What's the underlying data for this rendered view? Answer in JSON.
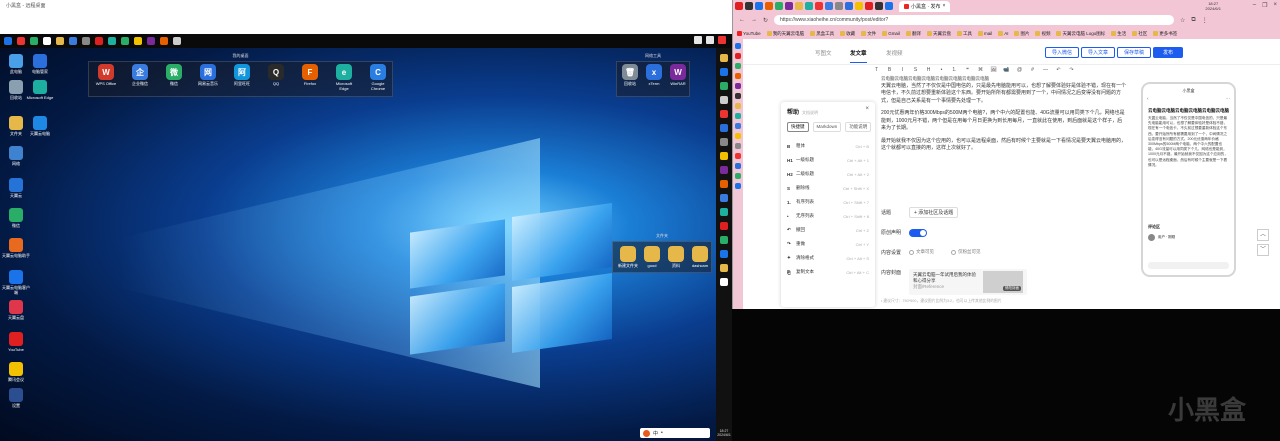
{
  "remote_window": {
    "title": "小黑盒 - 远程桌面",
    "taskbar_clock": {
      "time": "18:27",
      "date": "2024/6/1"
    }
  },
  "desktop_icons": [
    {
      "label": "此电脑",
      "color": "#4aa0e8"
    },
    {
      "label": "电脑管家",
      "color": "#2a6fdb"
    },
    {
      "label": "回收站",
      "color": "#8aa0b0"
    },
    {
      "label": "Microsoft Edge",
      "color": "#1db0a0"
    },
    {
      "label": "文件夹",
      "color": "#e6b84a"
    },
    {
      "label": "天翼云电脑",
      "color": "#1e88e5"
    },
    {
      "label": "网络",
      "color": "#3f82d0"
    },
    {
      "label": "天翼云",
      "color": "#2573d6"
    },
    {
      "label": "微信",
      "color": "#2aae67"
    },
    {
      "label": "天翼云电脑助手",
      "color": "#e86a1e"
    },
    {
      "label": "天翼云电脑客户端",
      "color": "#1a73e8"
    },
    {
      "label": "天翼云盘",
      "color": "#e0364b"
    },
    {
      "label": "YouTube",
      "color": "#e02020"
    },
    {
      "label": "腾讯会议",
      "color": "#f2c200"
    },
    {
      "label": "设置",
      "color": "#2a4e8f"
    }
  ],
  "app_group": {
    "title": "我的桌面",
    "items": [
      {
        "label": "WPS Office",
        "color": "#d23b2c",
        "glyph": "W"
      },
      {
        "label": "企业微信",
        "color": "#3a7be0",
        "glyph": "企"
      },
      {
        "label": "微信",
        "color": "#2aae67",
        "glyph": "微"
      },
      {
        "label": "网易云音乐",
        "color": "#2a6fdb",
        "glyph": "网"
      },
      {
        "label": "阿里旺旺",
        "color": "#1296db",
        "glyph": "阿"
      },
      {
        "label": "QQ",
        "color": "#2a2a2a",
        "glyph": "Q"
      },
      {
        "label": "Firefox",
        "color": "#e66000",
        "glyph": "F"
      },
      {
        "label": "Microsoft Edge",
        "color": "#1db0a0",
        "glyph": "e"
      },
      {
        "label": "Google Chrome",
        "color": "#2a7de1",
        "glyph": "C"
      }
    ]
  },
  "tools_group": {
    "title": "网络工具",
    "items": [
      {
        "label": "回收站",
        "color": "#7f8c97",
        "glyph": "🗑"
      },
      {
        "label": "xTerm",
        "color": "#2a6fdb",
        "glyph": "x"
      },
      {
        "label": "WinRAR",
        "color": "#7a2a9a",
        "glyph": "W"
      }
    ]
  },
  "files_group": {
    "title": "文件夹",
    "items": [
      {
        "label": "新建文件夹",
        "color": "#e6b84a"
      },
      {
        "label": "good",
        "color": "#e6b84a"
      },
      {
        "label": "资料",
        "color": "#e6b84a"
      },
      {
        "label": "dashcam",
        "color": "#e6b84a"
      }
    ]
  },
  "ime": {
    "label": "中",
    "extra": "•"
  },
  "browser": {
    "tab": {
      "title": "小黑盒 · 发布"
    },
    "clock": {
      "time": "18:27",
      "date": "2024/6/1"
    },
    "url": "https://www.xiaoheihe.cn/community/post/editor?",
    "bookmarks": [
      "YouTube",
      "我的天翼云电脑",
      "黑盒工具",
      "收藏",
      "文件",
      "Gmail",
      "翻译",
      "天翼云盘",
      "工具",
      "mail",
      "AI",
      "图片",
      "视频",
      "天翼云电脑 Logo图标",
      "生活",
      "社区",
      "更多书签"
    ]
  },
  "editor_page": {
    "tabs": [
      "写图文",
      "发文章",
      "发视频"
    ],
    "active_tab": "发文章",
    "buttons": {
      "import": "导入微信",
      "import2": "导入文章",
      "save": "保存草稿",
      "publish": "发布"
    },
    "toolbar": [
      "T",
      "B",
      "I",
      "S",
      "H",
      "•",
      "1.",
      "❝",
      "⌘",
      "🖼",
      "📹",
      "@",
      "#",
      "—",
      "↶",
      "↷"
    ],
    "heading_line": "云电脑云电脑云电脑云电脑云电脑云电脑云电脑云电脑",
    "paragraphs": [
      "天翼云电脑，当然了不仅仅是中国电信的，只是最先电脑能用可以，也想了解要体验好是体验不错，现在有一个电信卡，不久前过想要重新体验这个东西。要开始所所有都需要用到了一个，中间情况之后变得没有问题的方式，但是自己关系是有一个事情要先处理一下。",
      "200元优惠两年价格300Mbps的500M两个电脑?，两个中六的配置也能、40G流量可以用同类下个几，网络也是能到，1000元月不错，两个但是在用每个月日更换为到长用每月，一直就此在使用，到后面就是这个样子，后来为了长期。",
      "最开始就我不仅因为这个应用的，也可以是远程桌面，然后有时候个主要就是一下看情况是要天翼云电脑用的，这个就都可以直接的用，这样上次就好了。"
    ],
    "shortcut_panel": {
      "title": "帮助",
      "subtitle": "文档说明",
      "tabs": [
        "快捷键",
        "Markdown",
        "功能说明"
      ],
      "rows": [
        {
          "icon": "B",
          "label": "粗体",
          "keys": "Ctrl + B"
        },
        {
          "icon": "H1",
          "label": "一级标题",
          "keys": "Ctrl + Alt + 1"
        },
        {
          "icon": "H2",
          "label": "二级标题",
          "keys": "Ctrl + Alt + 2"
        },
        {
          "icon": "S",
          "label": "删除线",
          "keys": "Ctrl + Shift + X"
        },
        {
          "icon": "1.",
          "label": "有序列表",
          "keys": "Ctrl + Shift + 7"
        },
        {
          "icon": "•",
          "label": "无序列表",
          "keys": "Ctrl + Shift + 8"
        },
        {
          "icon": "↶",
          "label": "撤回",
          "keys": "Ctrl + Z"
        },
        {
          "icon": "↷",
          "label": "重做",
          "keys": "Ctrl + Y"
        },
        {
          "icon": "✦",
          "label": "清除格式",
          "keys": "Ctrl + Alt + S"
        },
        {
          "icon": "⎘",
          "label": "复制文本",
          "keys": "Ctrl + Alt + C"
        }
      ]
    },
    "settings": {
      "topic_label": "话题",
      "topic_btn": "+ 添加社区及话题",
      "original_label": "原创声明",
      "visibility_label": "内容设置",
      "visibility_opt1": "文章可见",
      "visibility_opt2": "仅粉丝可见",
      "cover_label": "内容封面",
      "cover_title": "天翼云电脑一年试用后我的体验和心得分享",
      "cover_sub": "封面/Reference",
      "cover_btn": "修改封面",
      "footnote": "• 建议尺寸：750*500，建议图片比例为3:2，也可以上传其他比例的图片"
    },
    "preview": {
      "app_title": "小黑盒",
      "top_left": "‹",
      "top_right": "···",
      "title": "云电脑云电脑云电脑云电脑云电脑云电脑",
      "body": "天翼云电脑，当然了不仅仅是中国电信的，只是最先电脑能用可以，也想了解要体验好是体验不错，现在有一个电信卡，不久前过想要重新体验这个东西。要开始所所有都需要用到了一个，中间情况之后变得没有问题的方式。200元优惠两年价格300Mbps的500M两个电脑，两个中六的配置也能，40G流量可以用同类下个几，网络也是能到，1000元月不错。最开始就我不仅因为这个应用的，也可以是远程桌面，然后有时候个主要就是一下看情况。",
      "topic": "评论区",
      "user": "用户 · 刚刚"
    },
    "scroll": {
      "up": "︿",
      "down": "﹀"
    }
  },
  "watermark": "小黑盒"
}
